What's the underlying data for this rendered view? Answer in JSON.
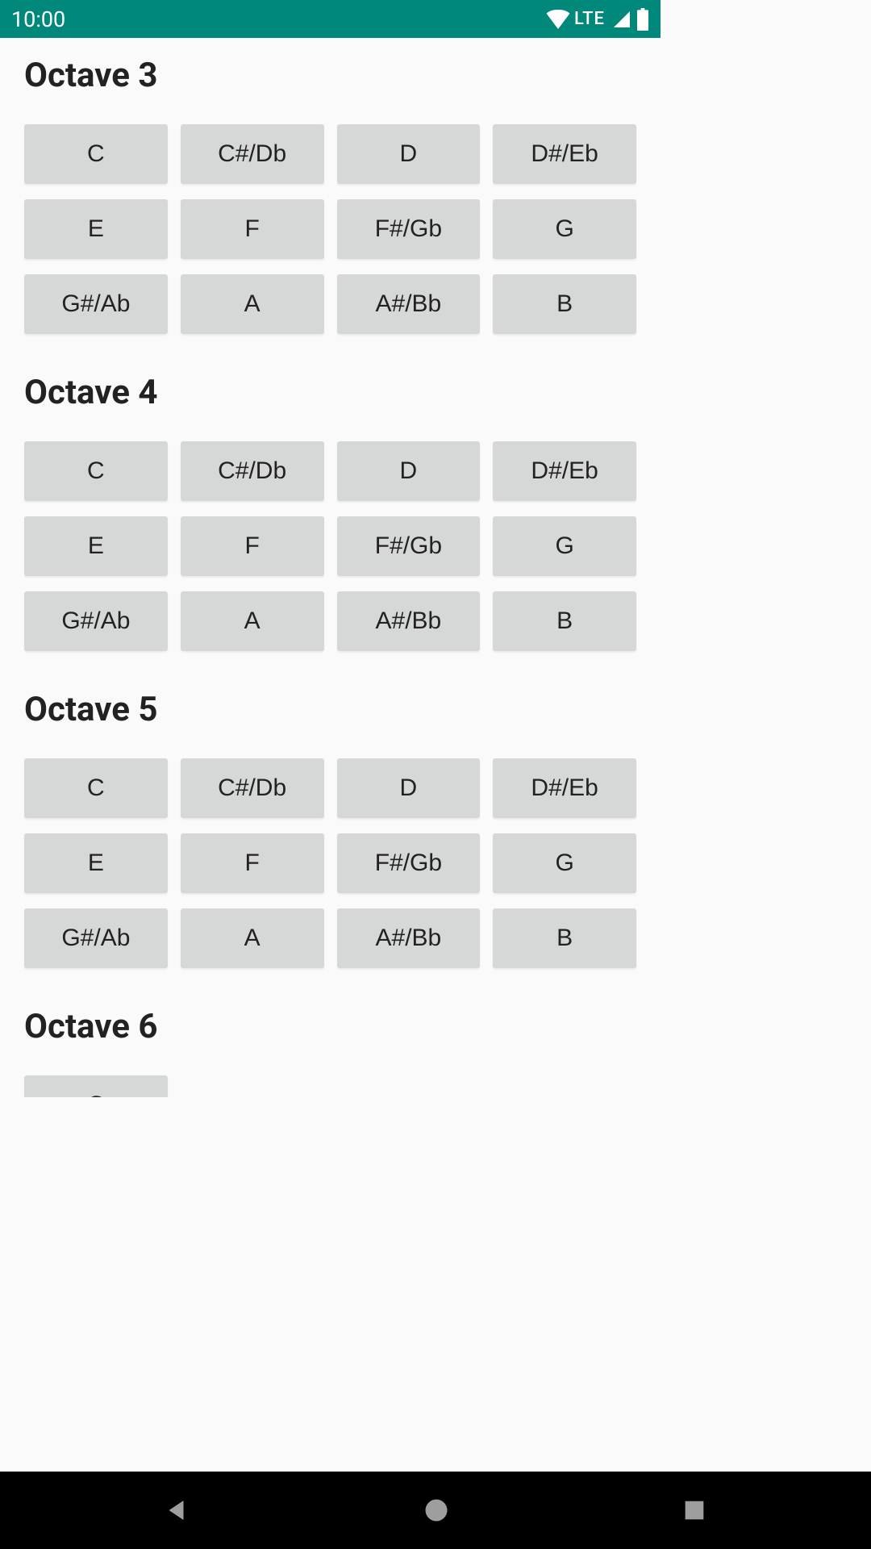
{
  "statusBar": {
    "time": "10:00",
    "networkType": "LTE"
  },
  "noteLabels": {
    "c": "C",
    "cs": "C#/Db",
    "d": "D",
    "ds": "D#/Eb",
    "e": "E",
    "f": "F",
    "fs": "F#/Gb",
    "g": "G",
    "gs": "G#/Ab",
    "a": "A",
    "as": "A#/Bb",
    "b": "B"
  },
  "octaves": [
    {
      "title": "Octave 3",
      "notes": [
        "c",
        "cs",
        "d",
        "ds",
        "e",
        "f",
        "fs",
        "g",
        "gs",
        "a",
        "as",
        "b"
      ]
    },
    {
      "title": "Octave 4",
      "notes": [
        "c",
        "cs",
        "d",
        "ds",
        "e",
        "f",
        "fs",
        "g",
        "gs",
        "a",
        "as",
        "b"
      ]
    },
    {
      "title": "Octave 5",
      "notes": [
        "c",
        "cs",
        "d",
        "ds",
        "e",
        "f",
        "fs",
        "g",
        "gs",
        "a",
        "as",
        "b"
      ]
    },
    {
      "title": "Octave 6",
      "notes": [
        "c"
      ]
    }
  ]
}
